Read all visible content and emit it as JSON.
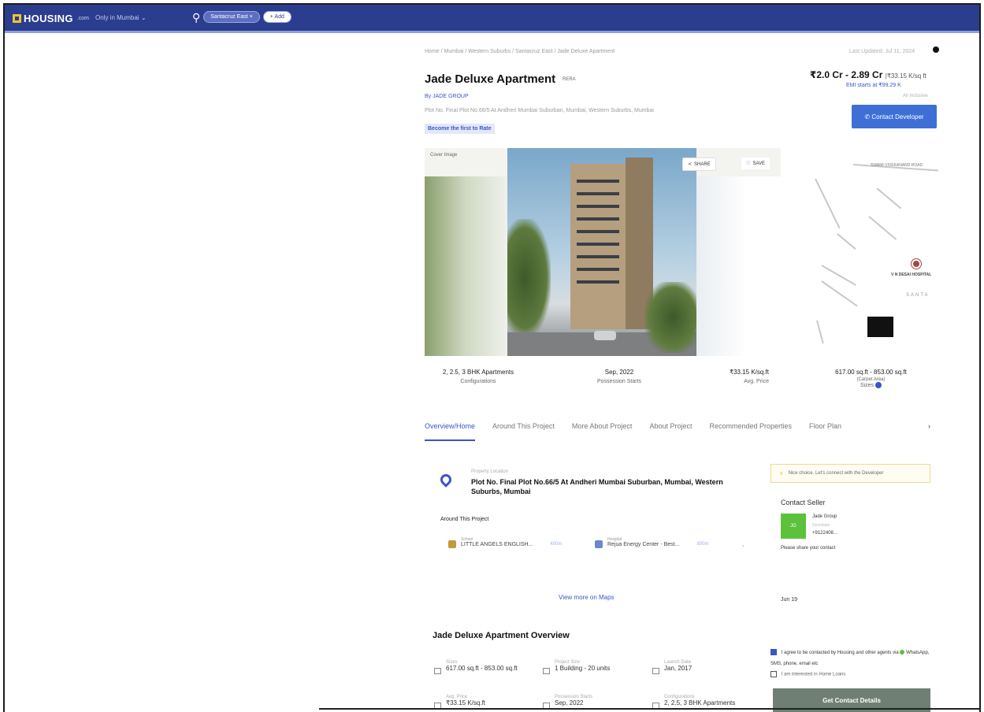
{
  "topbar": {
    "brand": "HOUSING",
    "brand_sub": ".com",
    "city": "Only in Mumbai",
    "search_chip": "Santacruz East",
    "add_label": "+ Add"
  },
  "breadcrumb": "Home / Mumbai / Western Suburbs / Santacruz East / Jade Deluxe Apartment",
  "updated": "Last Updated: Jul 11, 2024",
  "project": {
    "title": "Jade Deluxe Apartment",
    "rera": "RERA",
    "by": "By JADE GROUP",
    "address": "Plot No. Final Plot No.66/5 At Andheri Mumbai Suburban, Mumbai, Western Suburbs, Mumbai",
    "rate_badge": "Become the first to Rate"
  },
  "price": {
    "range": "₹2.0 Cr - 2.89 Cr",
    "rate": "|₹33.15 K/sq ft",
    "emi": "EMI starts at ₹99.29 K",
    "all_inclusive": "All Inclusive",
    "contact_button": "Contact Developer"
  },
  "gallery": {
    "cover_label": "Cover Image",
    "share_label": "SHARE",
    "save_label": "SAVE"
  },
  "map": {
    "road1": "SWAMI VIVEKANAND ROAD",
    "hospital": "V N DESAI HOSPITAL",
    "area": "SANTA"
  },
  "stats": [
    {
      "value": "2, 2.5, 3 BHK Apartments",
      "label": "Configurations"
    },
    {
      "value": "Sep, 2022",
      "label": "Possession Starts"
    },
    {
      "value": "₹33.15 K/sq.ft",
      "label": "Avg. Price"
    },
    {
      "value": "617.00 sq.ft - 853.00 sq.ft",
      "label": "(Carpet Area)",
      "sub": "Sizes"
    }
  ],
  "tabs": [
    "Overview/Home",
    "Around This Project",
    "More About Project",
    "About Project",
    "Recommended Properties",
    "Floor Plan"
  ],
  "tab_more": "›",
  "location": {
    "label": "Property Location",
    "address": "Plot No. Final Plot No.66/5 At Andheri Mumbai Suburban, Mumbai, Western Suburbs, Mumbai",
    "around_title": "Around This Project",
    "items": [
      {
        "category": "School",
        "name": "LITTLE ANGELS ENGLISH...",
        "distance": "400m"
      },
      {
        "category": "Hospital",
        "name": "Rejua Energy Center - Best...",
        "distance": "800m"
      }
    ],
    "arrow": "›",
    "view_maps": "View more on Maps"
  },
  "side_note": "Jun 19",
  "seller": {
    "nice_choice": "Nice choice. Let's connect with the Developer",
    "heading": "Contact Seller",
    "avatar": "JG",
    "name": "Jade Group",
    "role": "Developer",
    "phone": "+9122408...",
    "share_prompt": "Please share your contact"
  },
  "overview": {
    "title": "Jade Deluxe Apartment Overview",
    "items": [
      {
        "label": "Sizes",
        "value": "617.00 sq.ft - 853.00 sq.ft"
      },
      {
        "label": "Project Size",
        "value": "1 Building - 20 units"
      },
      {
        "label": "Launch Date",
        "value": "Jan, 2017"
      },
      {
        "label": "Avg. Price",
        "value": "₹33.15 K/sq.ft"
      },
      {
        "label": "Possession Starts",
        "value": "Sep, 2022"
      },
      {
        "label": "Configurations",
        "value": "2, 2.5, 3 BHK Apartments"
      }
    ]
  },
  "consent": {
    "text1": "I agree to be contacted by Housing and other agents via",
    "text1b": "WhatsApp, SMS, phone, email etc",
    "text2": "I am interested in Home Loans",
    "button": "Get Contact Details"
  },
  "colors": {
    "brand": "#2b3d8f",
    "accent": "#3a55c9",
    "cta": "#3d6fd6"
  }
}
